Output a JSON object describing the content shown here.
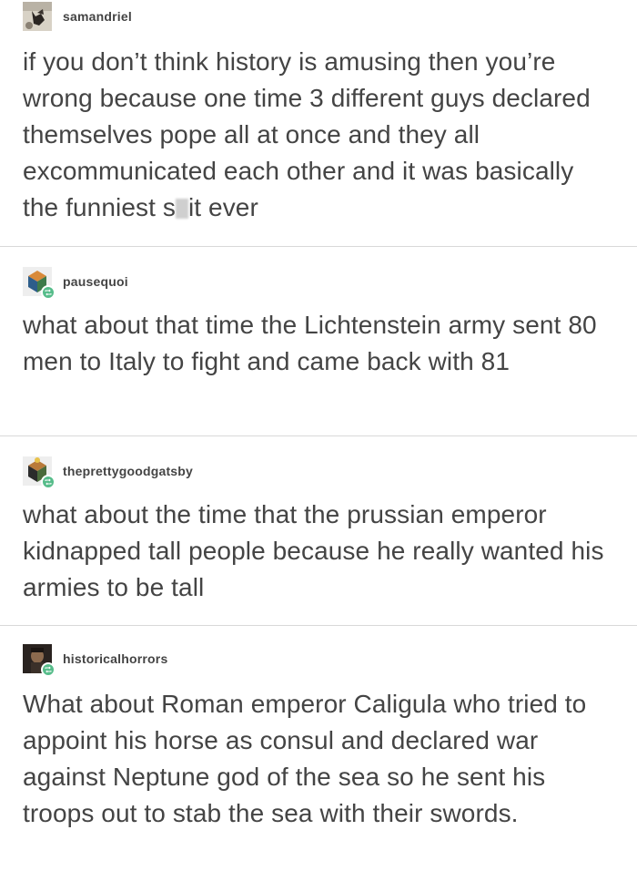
{
  "posts": [
    {
      "username": "samandriel",
      "avatar_icon": "cat-face-avatar",
      "reblog": false,
      "text_before": "if you don’t think history is amusing then you’re wrong because one time 3 different guys declared themselves pope all at once and they all excommunicated each other and it was basically the funniest s",
      "censored": true,
      "text_after": "it ever"
    },
    {
      "username": "pausequoi",
      "avatar_icon": "cube-avatar",
      "reblog": true,
      "text": "what about that time the Lichtenstein army sent 80 men to Italy to fight and came back with 81"
    },
    {
      "username": "theprettygoodgatsby",
      "avatar_icon": "cube-avatar",
      "reblog": true,
      "text": "what about the time that the prussian emperor kidnapped tall people because he really wanted his armies to be tall"
    },
    {
      "username": "historicalhorrors",
      "avatar_icon": "portrait-avatar",
      "reblog": true,
      "text": "What about Roman emperor Caligula who tried to appoint his horse as consul and declared war against Neptune god of the sea so he sent his troops out to stab the sea with their swords."
    }
  ],
  "colors": {
    "text": "#444444",
    "divider": "#d9d9d9",
    "reblog_badge": "#56bc8a"
  }
}
